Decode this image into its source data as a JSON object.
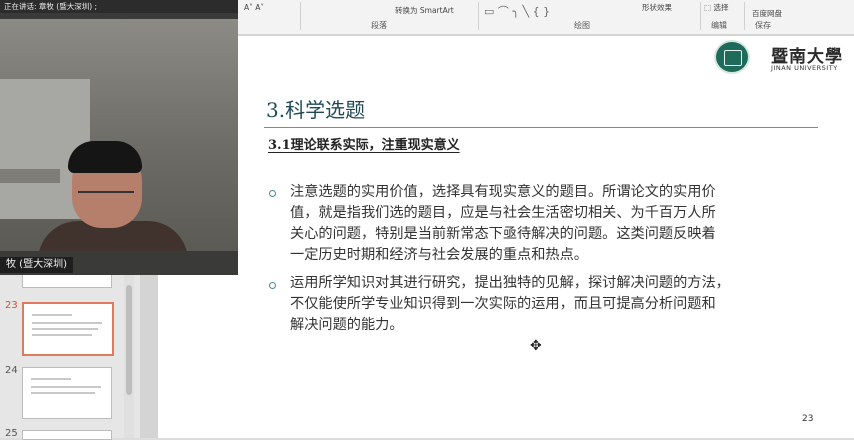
{
  "meeting": {
    "speaker_text": "正在讲话: 章牧 (暨大深圳) ;",
    "participant_name": "牧 (暨大深圳)"
  },
  "ribbon": {
    "convert_smartart": "转换为 SmartArt",
    "paragraph_group": "段落",
    "drawing_group": "绘图",
    "shape_effects": "形状效果",
    "select": "选择",
    "editing_group": "编辑",
    "save_to_baidu": "百度网盘",
    "save_group": "保存"
  },
  "thumbnails": [
    {
      "number": "23",
      "active": true
    },
    {
      "number": "24",
      "active": false
    },
    {
      "number": "25",
      "active": false
    }
  ],
  "slide": {
    "logo_cn": "暨南大學",
    "logo_en": "JINAN UNIVERSITY",
    "title": "3.科学选题",
    "subtitle": "3.1理论联系实际，注重现实意义",
    "bullets": [
      {
        "lines": [
          "注意选题的实用价值，选择具有现实意义的题目。所谓论文的实用价",
          "值，就是指我们选的题目，应是与社会生活密切相关、为千百万人所",
          "关心的问题，特别是当前新常态下亟待解决的问题。这类问题反映着",
          "一定历史时期和经济与社会发展的重点和热点。"
        ]
      },
      {
        "lines": [
          "运用所学知识对其进行研究，提出独特的见解，探讨解决问题的方法，",
          "不仅能使所学专业知识得到一次实际的运用，而且可提高分析问题和",
          "解决问题的能力。"
        ]
      }
    ],
    "page_number": "23"
  },
  "icons": {
    "cursor": "move-cursor-icon",
    "bullet": "hollow-circle-bullet-icon",
    "logo": "university-seal-icon"
  },
  "colors": {
    "title": "#1f4a54",
    "bullet": "#4c8a8f",
    "logo": "#1f6b5b",
    "active_thumb": "#e07a5f"
  }
}
